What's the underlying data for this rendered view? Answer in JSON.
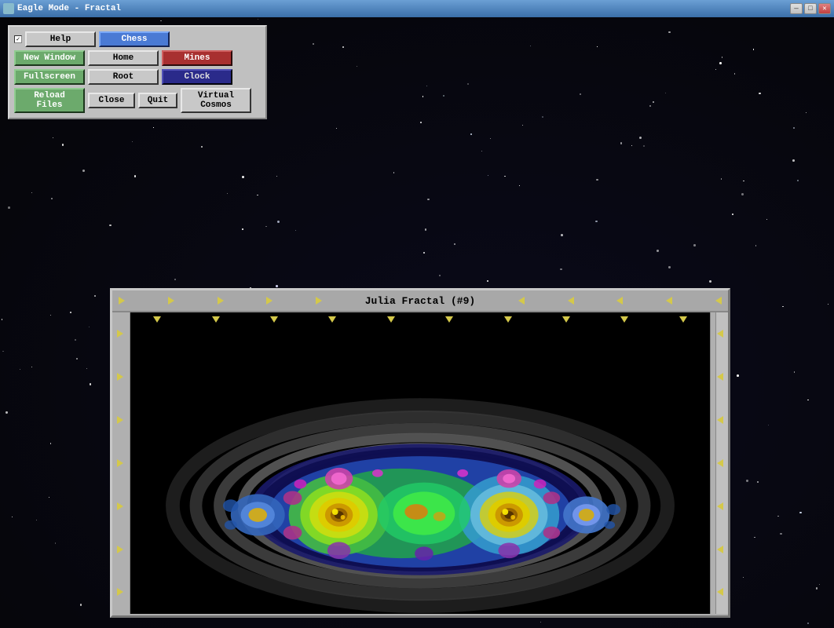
{
  "titleBar": {
    "title": "Eagle Mode - Fractal",
    "controls": {
      "minimize": "—",
      "maximize": "□",
      "close": "✕"
    }
  },
  "menuPanel": {
    "checkbox": "✓",
    "buttons": {
      "help": "Help",
      "chess": "Chess",
      "home": "Home",
      "mines": "Mines",
      "root": "Root",
      "clock": "Clock",
      "newWindow": "New Window",
      "fullscreen": "Fullscreen",
      "reloadFiles": "Reload Files",
      "close": "Close",
      "quit": "Quit",
      "virtualCosmos": "Virtual Cosmos"
    }
  },
  "fractalWindow": {
    "title": "Julia Fractal (#9)"
  },
  "arrows": {
    "symbol": "▶"
  }
}
